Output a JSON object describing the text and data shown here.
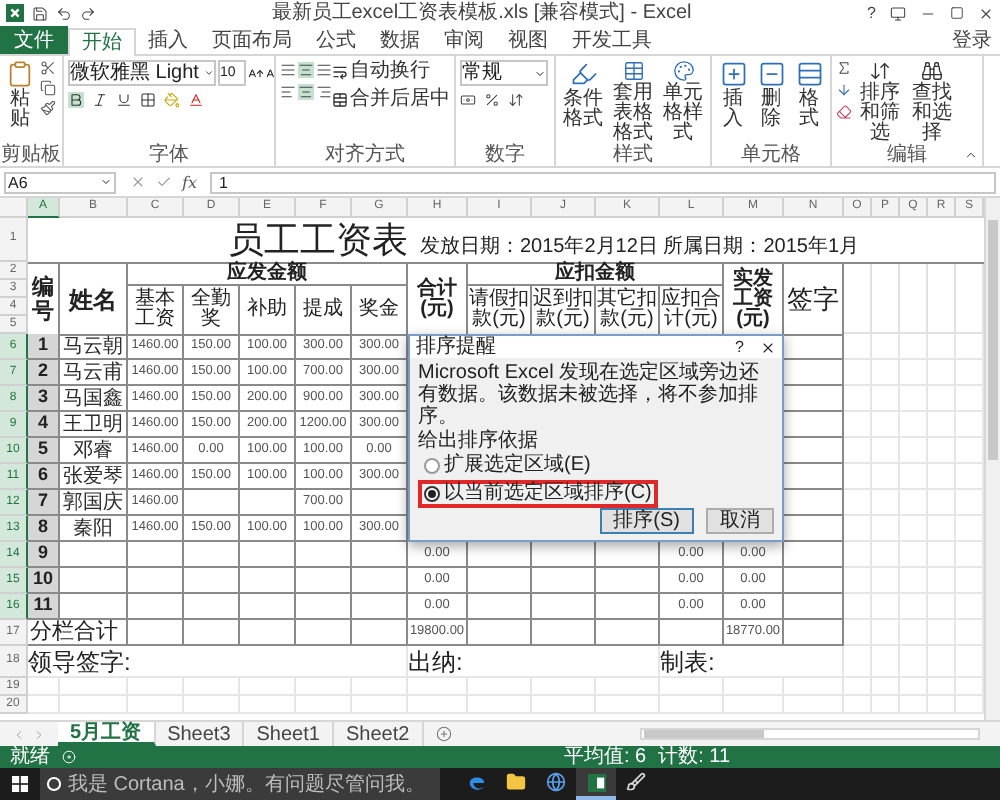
{
  "window": {
    "title": "最新员工excel工资表模板.xls [兼容模式] - Excel",
    "help": "?"
  },
  "ribbon_tabs": [
    {
      "label": "文件",
      "kind": "file",
      "selected": false
    },
    {
      "label": "开始",
      "kind": "tab",
      "selected": true
    },
    {
      "label": "插入",
      "kind": "tab",
      "selected": false
    },
    {
      "label": "页面布局",
      "kind": "tab",
      "selected": false
    },
    {
      "label": "公式",
      "kind": "tab",
      "selected": false
    },
    {
      "label": "数据",
      "kind": "tab",
      "selected": false
    },
    {
      "label": "审阅",
      "kind": "tab",
      "selected": false
    },
    {
      "label": "视图",
      "kind": "tab",
      "selected": false
    },
    {
      "label": "开发工具",
      "kind": "tab",
      "selected": false
    }
  ],
  "sign_in": "登录",
  "ribbon": {
    "clipboard": {
      "paste": "粘贴",
      "label": "剪贴板"
    },
    "font": {
      "name": "微软雅黑 Light",
      "size": "10",
      "label": "字体"
    },
    "alignment": {
      "wrap": "自动换行",
      "merge": "合并后居中",
      "label": "对齐方式"
    },
    "number": {
      "format": "常规",
      "label": "数字"
    },
    "styles": {
      "buttons": [
        "条件格式",
        "套用表格格式",
        "单元格样式"
      ],
      "label": "样式"
    },
    "cells": {
      "buttons": [
        "插入",
        "删除",
        "格式"
      ],
      "label": "单元格"
    },
    "editing": {
      "buttons": [
        "排序和筛选",
        "查找和选择"
      ],
      "label": "编辑"
    }
  },
  "formula_bar": {
    "name_box": "A6",
    "fx": "fx",
    "value": "1"
  },
  "sheet": {
    "columns": [
      "A",
      "B",
      "C",
      "D",
      "E",
      "F",
      "G",
      "H",
      "I",
      "J",
      "K",
      "L",
      "M",
      "N",
      "O",
      "P",
      "Q",
      "R",
      "S"
    ],
    "title_row": {
      "row": "1",
      "title": "员工工资表",
      "subtitle": "发放日期：2015年2月12日 所属日期：2015年1月"
    },
    "header_rows": [
      "2",
      "3",
      "4",
      "5"
    ],
    "headers": {
      "number": "编号",
      "name": "姓名",
      "earnings": "应发金额",
      "earning_items": [
        "基本工资",
        "全勤奖",
        "补助",
        "提成",
        "奖金"
      ],
      "total": "合计(元)",
      "deductions": "应扣金额",
      "deduction_items": [
        "请假扣款(元)",
        "迟到扣款(元)",
        "其它扣款(元)",
        "应扣合计(元)"
      ],
      "net": "实发工资(元)",
      "signature": "签字"
    },
    "rows": [
      {
        "row": "6",
        "kind": "data",
        "selected": true,
        "cells": {
          "A": "1",
          "B": "马云朝",
          "C": "1460.00",
          "D": "150.00",
          "E": "100.00",
          "F": "300.00",
          "G": "300.00"
        }
      },
      {
        "row": "7",
        "kind": "data",
        "selected": true,
        "cells": {
          "A": "2",
          "B": "马云甫",
          "C": "1460.00",
          "D": "150.00",
          "E": "100.00",
          "F": "700.00",
          "G": "300.00"
        }
      },
      {
        "row": "8",
        "kind": "data",
        "selected": true,
        "cells": {
          "A": "3",
          "B": "马国鑫",
          "C": "1460.00",
          "D": "150.00",
          "E": "200.00",
          "F": "900.00",
          "G": "300.00"
        }
      },
      {
        "row": "9",
        "kind": "data",
        "selected": true,
        "cells": {
          "A": "4",
          "B": "王卫明",
          "C": "1460.00",
          "D": "150.00",
          "E": "200.00",
          "F": "1200.00",
          "G": "300.00"
        }
      },
      {
        "row": "10",
        "kind": "data",
        "selected": true,
        "cells": {
          "A": "5",
          "B": "邓睿",
          "C": "1460.00",
          "D": "0.00",
          "E": "100.00",
          "F": "100.00",
          "G": "0.00"
        }
      },
      {
        "row": "11",
        "kind": "data",
        "selected": true,
        "cells": {
          "A": "6",
          "B": "张爱琴",
          "C": "1460.00",
          "D": "150.00",
          "E": "100.00",
          "F": "100.00",
          "G": "300.00"
        }
      },
      {
        "row": "12",
        "kind": "data",
        "selected": true,
        "cells": {
          "A": "7",
          "B": "郭国庆",
          "C": "1460.00",
          "F": "700.00"
        }
      },
      {
        "row": "13",
        "kind": "data",
        "selected": true,
        "cells": {
          "A": "8",
          "B": "秦阳",
          "C": "1460.00",
          "D": "150.00",
          "E": "100.00",
          "F": "100.00",
          "G": "300.00"
        }
      },
      {
        "row": "14",
        "kind": "data",
        "selected": true,
        "cells": {
          "A": "9",
          "H": "0.00",
          "L": "0.00",
          "M": "0.00"
        }
      },
      {
        "row": "15",
        "kind": "data",
        "selected": true,
        "cells": {
          "A": "10",
          "H": "0.00",
          "L": "0.00",
          "M": "0.00"
        }
      },
      {
        "row": "16",
        "kind": "data",
        "selected": true,
        "cells": {
          "A": "11",
          "H": "0.00",
          "L": "0.00",
          "M": "0.00"
        }
      },
      {
        "row": "17",
        "kind": "total",
        "cells": {
          "A": "分栏合计",
          "H": "19800.00",
          "M": "18770.00"
        }
      },
      {
        "row": "18",
        "kind": "signature",
        "cells": {
          "A": "领导签字:",
          "H": "出纳:",
          "L": "制表:"
        }
      },
      {
        "row": "19",
        "kind": "empty"
      },
      {
        "row": "20",
        "kind": "empty"
      }
    ]
  },
  "dialog": {
    "title": "排序提醒",
    "help": "?",
    "message": "Microsoft Excel 发现在选定区域旁边还有数据。该数据未被选择，将不参加排序。",
    "group_label": "给出排序依据",
    "options": [
      {
        "label": "扩展选定区域(E)",
        "selected": false,
        "highlighted": false
      },
      {
        "label": "以当前选定区域排序(C)",
        "selected": true,
        "highlighted": true
      }
    ],
    "buttons": [
      {
        "label": "排序(S)",
        "kind": "primary"
      },
      {
        "label": "取消",
        "kind": "secondary"
      }
    ]
  },
  "sheet_tabs": [
    {
      "label": "5月工资",
      "selected": true
    },
    {
      "label": "Sheet3",
      "selected": false
    },
    {
      "label": "Sheet1",
      "selected": false
    },
    {
      "label": "Sheet2",
      "selected": false
    }
  ],
  "status_bar": {
    "ready": "就绪",
    "average": "平均值: 6",
    "count": "计数: 11"
  },
  "taskbar": {
    "search_placeholder": "我是 Cortana，小娜。有问题尽管问我。",
    "apps": [
      {
        "kind": "browser",
        "selected": false
      },
      {
        "kind": "folder",
        "selected": false
      },
      {
        "kind": "globe",
        "selected": false
      },
      {
        "kind": "spreadsheet",
        "selected": true
      },
      {
        "kind": "paint",
        "selected": false
      }
    ]
  }
}
